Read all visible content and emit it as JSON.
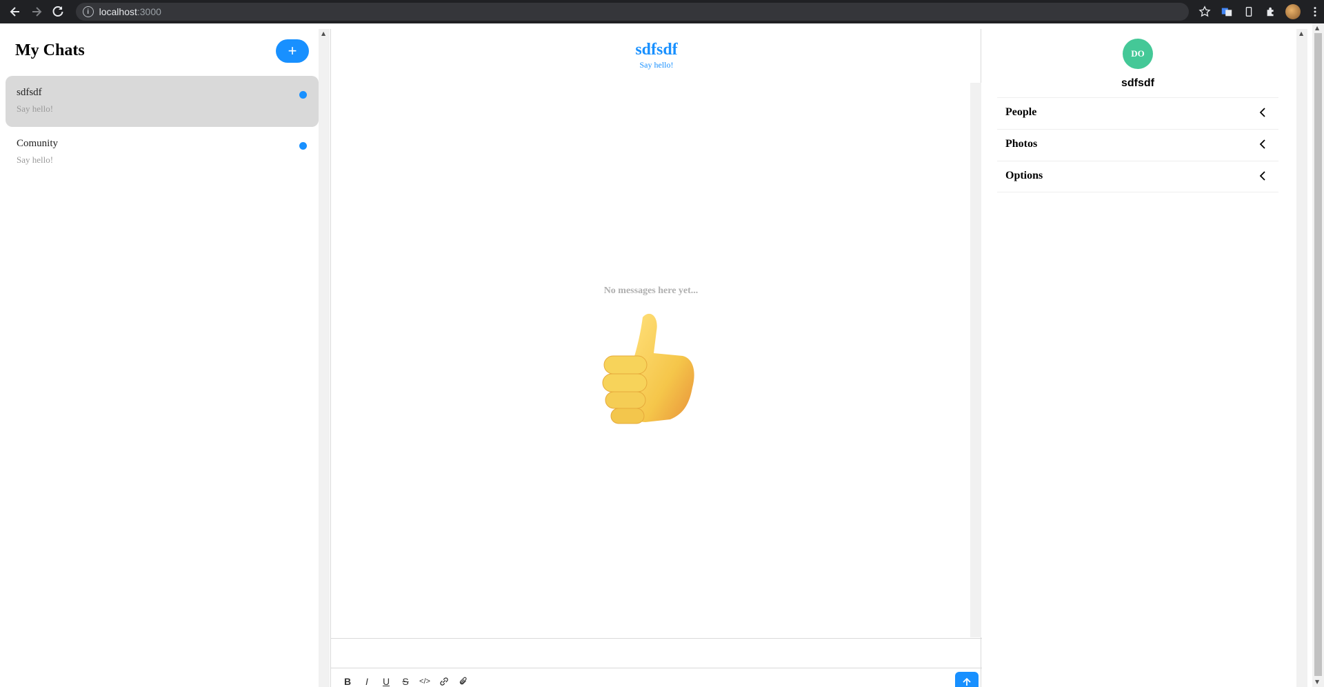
{
  "browser": {
    "url_host": "localhost",
    "url_port": ":3000"
  },
  "sidebar": {
    "title": "My Chats",
    "new_chat_label": "+",
    "chats": [
      {
        "title": "sdfsdf",
        "subtitle": "Say hello!",
        "active": true
      },
      {
        "title": "Comunity",
        "subtitle": "Say hello!",
        "active": false
      }
    ]
  },
  "feed": {
    "title": "sdfsdf",
    "subtitle": "Say hello!",
    "empty_text": "No messages here yet...",
    "empty_icon": "thumbs-up-emoji",
    "toolbar": [
      "B",
      "I",
      "U",
      "S",
      "</>",
      "link",
      "attach"
    ]
  },
  "settings": {
    "avatar_initials": "DO",
    "chat_title": "sdfsdf",
    "sections": [
      "People",
      "Photos",
      "Options"
    ]
  },
  "colors": {
    "accent": "#1890ff",
    "avatar": "#44c897",
    "active_chat": "#d9d9d9"
  }
}
